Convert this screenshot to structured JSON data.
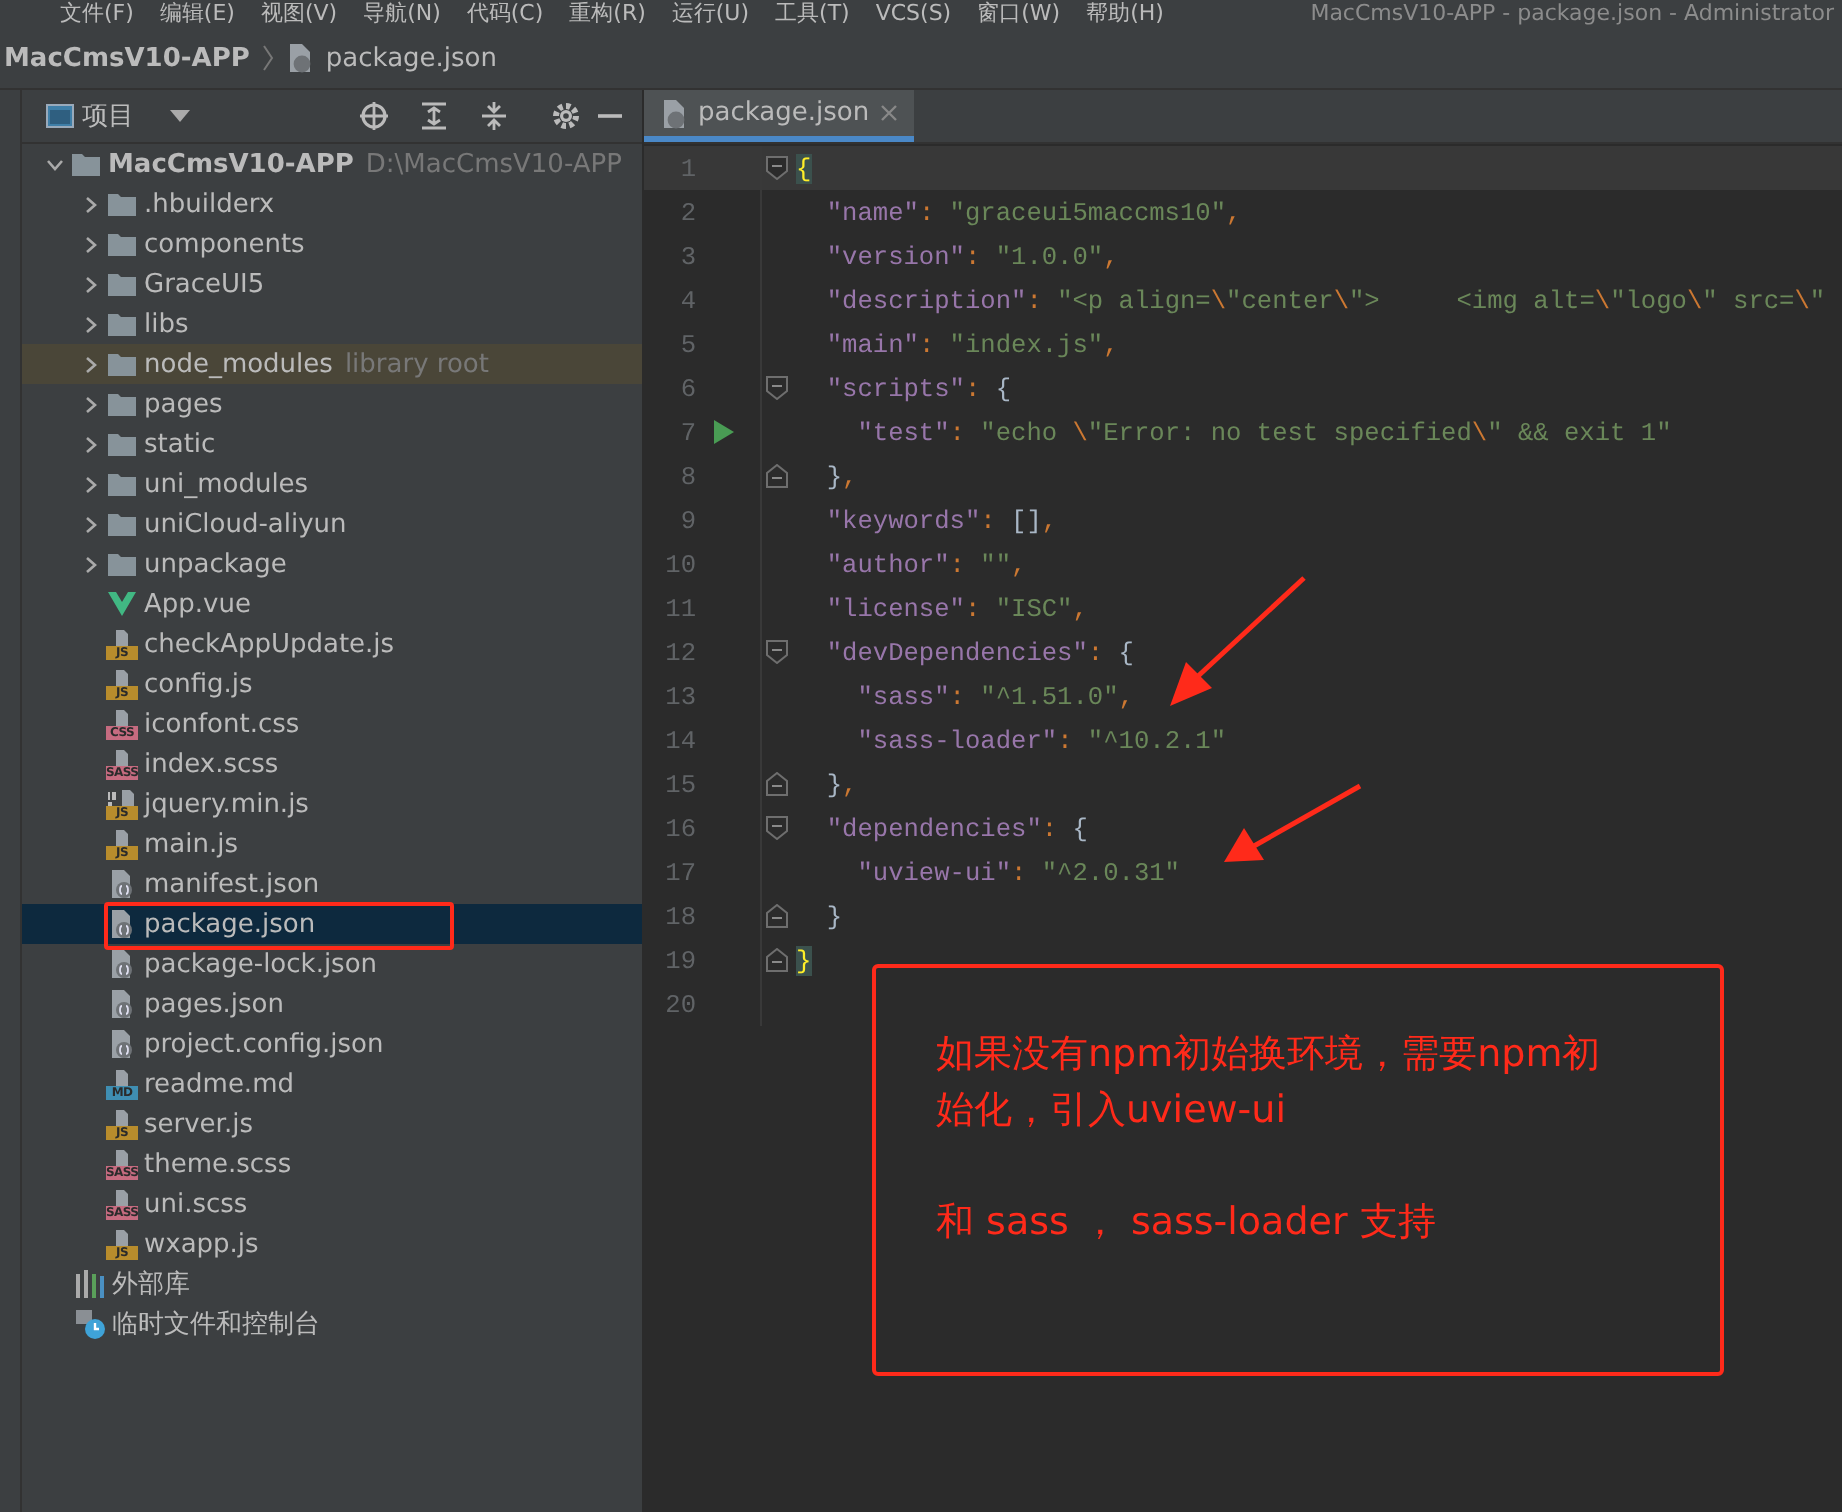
{
  "menu": [
    "文件(F)",
    "编辑(E)",
    "视图(V)",
    "导航(N)",
    "代码(C)",
    "重构(R)",
    "运行(U)",
    "工具(T)",
    "VCS(S)",
    "窗口(W)",
    "帮助(H)"
  ],
  "window_title": "MacCmsV10-APP - package.json - Administrator",
  "breadcrumb": {
    "project": "MacCmsV10-APP",
    "file": "package.json"
  },
  "project_panel": {
    "title": "项目",
    "tree": [
      {
        "label": "MacCmsV10-APP",
        "path": "D:\\MacCmsV10-APP",
        "kind": "folder",
        "expanded": true,
        "selected": false,
        "marked": false,
        "children": [
          {
            "label": ".hbuilderx",
            "kind": "folder",
            "expanded": false,
            "selected": false,
            "marked": false
          },
          {
            "label": "components",
            "kind": "folder",
            "expanded": false,
            "selected": false,
            "marked": false
          },
          {
            "label": "GraceUI5",
            "kind": "folder",
            "expanded": false,
            "selected": false,
            "marked": false
          },
          {
            "label": "libs",
            "kind": "folder",
            "expanded": false,
            "selected": false,
            "marked": false
          },
          {
            "label": "node_modules",
            "hint": "library root",
            "kind": "folder",
            "expanded": false,
            "selected": false,
            "marked": true
          },
          {
            "label": "pages",
            "kind": "folder",
            "expanded": false,
            "selected": false,
            "marked": false
          },
          {
            "label": "static",
            "kind": "folder",
            "expanded": false,
            "selected": false,
            "marked": false
          },
          {
            "label": "uni_modules",
            "kind": "folder",
            "expanded": false,
            "selected": false,
            "marked": false
          },
          {
            "label": "uniCloud-aliyun",
            "kind": "folder",
            "expanded": false,
            "selected": false,
            "marked": false
          },
          {
            "label": "unpackage",
            "kind": "folder",
            "expanded": false,
            "selected": false,
            "marked": false
          },
          {
            "label": "App.vue",
            "kind": "vue",
            "selected": false,
            "marked": false
          },
          {
            "label": "checkAppUpdate.js",
            "kind": "js",
            "badge": "JS",
            "selected": false,
            "marked": false
          },
          {
            "label": "config.js",
            "kind": "js",
            "badge": "JS",
            "selected": false,
            "marked": false
          },
          {
            "label": "iconfont.css",
            "kind": "css",
            "badge": "CSS",
            "selected": false,
            "marked": false
          },
          {
            "label": "index.scss",
            "kind": "scss",
            "badge": "SASS",
            "selected": false,
            "marked": false
          },
          {
            "label": "jquery.min.js",
            "kind": "minjs",
            "badge": "JS",
            "selected": false,
            "marked": false
          },
          {
            "label": "main.js",
            "kind": "js",
            "badge": "JS",
            "selected": false,
            "marked": false
          },
          {
            "label": "manifest.json",
            "kind": "json",
            "selected": false,
            "marked": false
          },
          {
            "label": "package.json",
            "kind": "json",
            "selected": true,
            "marked": false,
            "boxed": true
          },
          {
            "label": "package-lock.json",
            "kind": "json",
            "selected": false,
            "marked": false
          },
          {
            "label": "pages.json",
            "kind": "json",
            "selected": false,
            "marked": false
          },
          {
            "label": "project.config.json",
            "kind": "json",
            "selected": false,
            "marked": false
          },
          {
            "label": "readme.md",
            "kind": "md",
            "badge": "MD",
            "selected": false,
            "marked": false
          },
          {
            "label": "server.js",
            "kind": "js",
            "badge": "JS",
            "selected": false,
            "marked": false
          },
          {
            "label": "theme.scss",
            "kind": "scss",
            "badge": "SASS",
            "selected": false,
            "marked": false
          },
          {
            "label": "uni.scss",
            "kind": "scss",
            "badge": "SASS",
            "selected": false,
            "marked": false
          },
          {
            "label": "wxapp.js",
            "kind": "js",
            "badge": "JS",
            "selected": false,
            "marked": false
          }
        ]
      }
    ],
    "extras": [
      {
        "kind": "libraries",
        "label": "外部库"
      },
      {
        "kind": "scratches",
        "label": "临时文件和控制台"
      }
    ]
  },
  "editor": {
    "tabs": [
      {
        "label": "package.json",
        "selected": true
      }
    ],
    "lines": [
      {
        "n": "1",
        "marker": {
          "kind": "fold-start"
        },
        "current": true,
        "tokens": [
          {
            "kind": "match",
            "text": "{"
          }
        ]
      },
      {
        "n": "2",
        "current": false,
        "tokens": [
          {
            "kind": "key",
            "text": "  \"name\""
          },
          {
            "kind": "op",
            "text": ": "
          },
          {
            "kind": "str",
            "text": "\"graceui5maccms10\""
          },
          {
            "kind": "op",
            "text": ","
          }
        ]
      },
      {
        "n": "3",
        "current": false,
        "tokens": [
          {
            "kind": "key",
            "text": "  \"version\""
          },
          {
            "kind": "op",
            "text": ": "
          },
          {
            "kind": "str",
            "text": "\"1.0.0\""
          },
          {
            "kind": "op",
            "text": ","
          }
        ]
      },
      {
        "n": "4",
        "current": false,
        "tokens": [
          {
            "kind": "key",
            "text": "  \"description\""
          },
          {
            "kind": "op",
            "text": ": "
          },
          {
            "kind": "str",
            "text": "\"<p align="
          },
          {
            "kind": "op",
            "text": "\\"
          },
          {
            "kind": "str",
            "text": "\"center"
          },
          {
            "kind": "op",
            "text": "\\"
          },
          {
            "kind": "str",
            "text": "\">     <img alt="
          },
          {
            "kind": "op",
            "text": "\\"
          },
          {
            "kind": "str",
            "text": "\"logo"
          },
          {
            "kind": "op",
            "text": "\\"
          },
          {
            "kind": "str",
            "text": "\" src="
          },
          {
            "kind": "op",
            "text": "\\"
          },
          {
            "kind": "str",
            "text": "\""
          }
        ]
      },
      {
        "n": "5",
        "current": false,
        "tokens": [
          {
            "kind": "key",
            "text": "  \"main\""
          },
          {
            "kind": "op",
            "text": ": "
          },
          {
            "kind": "str",
            "text": "\"index.js\""
          },
          {
            "kind": "op",
            "text": ","
          }
        ]
      },
      {
        "n": "6",
        "marker": {
          "kind": "fold-start"
        },
        "current": false,
        "tokens": [
          {
            "kind": "key",
            "text": "  \"scripts\""
          },
          {
            "kind": "op",
            "text": ": "
          },
          {
            "kind": "punct",
            "text": "{"
          }
        ]
      },
      {
        "n": "7",
        "marker": {
          "kind": "run"
        },
        "current": false,
        "tokens": [
          {
            "kind": "key",
            "text": "    \"test\""
          },
          {
            "kind": "op",
            "text": ": "
          },
          {
            "kind": "str",
            "text": "\"echo "
          },
          {
            "kind": "op",
            "text": "\\"
          },
          {
            "kind": "str",
            "text": "\"Error: no test specified"
          },
          {
            "kind": "op",
            "text": "\\"
          },
          {
            "kind": "str",
            "text": "\" && exit 1\""
          }
        ]
      },
      {
        "n": "8",
        "marker": {
          "kind": "fold-end"
        },
        "current": false,
        "tokens": [
          {
            "kind": "punct",
            "text": "  }"
          },
          {
            "kind": "op",
            "text": ","
          }
        ]
      },
      {
        "n": "9",
        "current": false,
        "tokens": [
          {
            "kind": "key",
            "text": "  \"keywords\""
          },
          {
            "kind": "op",
            "text": ": "
          },
          {
            "kind": "punct",
            "text": "[]"
          },
          {
            "kind": "op",
            "text": ","
          }
        ]
      },
      {
        "n": "10",
        "current": false,
        "tokens": [
          {
            "kind": "key",
            "text": "  \"author\""
          },
          {
            "kind": "op",
            "text": ": "
          },
          {
            "kind": "str",
            "text": "\"\""
          },
          {
            "kind": "op",
            "text": ","
          }
        ]
      },
      {
        "n": "11",
        "current": false,
        "tokens": [
          {
            "kind": "key",
            "text": "  \"license\""
          },
          {
            "kind": "op",
            "text": ": "
          },
          {
            "kind": "str",
            "text": "\"ISC\""
          },
          {
            "kind": "op",
            "text": ","
          }
        ]
      },
      {
        "n": "12",
        "marker": {
          "kind": "fold-start"
        },
        "current": false,
        "tokens": [
          {
            "kind": "key",
            "text": "  \"devDependencies\""
          },
          {
            "kind": "op",
            "text": ": "
          },
          {
            "kind": "punct",
            "text": "{"
          }
        ]
      },
      {
        "n": "13",
        "current": false,
        "tokens": [
          {
            "kind": "key",
            "text": "    \"sass\""
          },
          {
            "kind": "op",
            "text": ": "
          },
          {
            "kind": "str",
            "text": "\"^1.51.0\""
          },
          {
            "kind": "op",
            "text": ","
          }
        ]
      },
      {
        "n": "14",
        "current": false,
        "tokens": [
          {
            "kind": "key",
            "text": "    \"sass-loader\""
          },
          {
            "kind": "op",
            "text": ": "
          },
          {
            "kind": "str",
            "text": "\"^10.2.1\""
          }
        ]
      },
      {
        "n": "15",
        "marker": {
          "kind": "fold-end"
        },
        "current": false,
        "tokens": [
          {
            "kind": "punct",
            "text": "  }"
          },
          {
            "kind": "op",
            "text": ","
          }
        ]
      },
      {
        "n": "16",
        "marker": {
          "kind": "fold-start"
        },
        "current": false,
        "tokens": [
          {
            "kind": "key",
            "text": "  \"dependencies\""
          },
          {
            "kind": "op",
            "text": ": "
          },
          {
            "kind": "punct",
            "text": "{"
          }
        ]
      },
      {
        "n": "17",
        "current": false,
        "tokens": [
          {
            "kind": "key",
            "text": "    \"uview-ui\""
          },
          {
            "kind": "op",
            "text": ": "
          },
          {
            "kind": "str",
            "text": "\"^2.0.31\""
          }
        ]
      },
      {
        "n": "18",
        "marker": {
          "kind": "fold-end"
        },
        "current": false,
        "tokens": [
          {
            "kind": "punct",
            "text": "  }"
          }
        ]
      },
      {
        "n": "19",
        "marker": {
          "kind": "fold-end"
        },
        "current": false,
        "tokens": [
          {
            "kind": "match",
            "text": "}"
          }
        ]
      },
      {
        "n": "20",
        "current": false
      }
    ]
  },
  "annotation": {
    "text": "如果没有npm初始换环境，需要npm初始化，引入uview-ui",
    "note": "和 sass ， sass-loader 支持"
  }
}
